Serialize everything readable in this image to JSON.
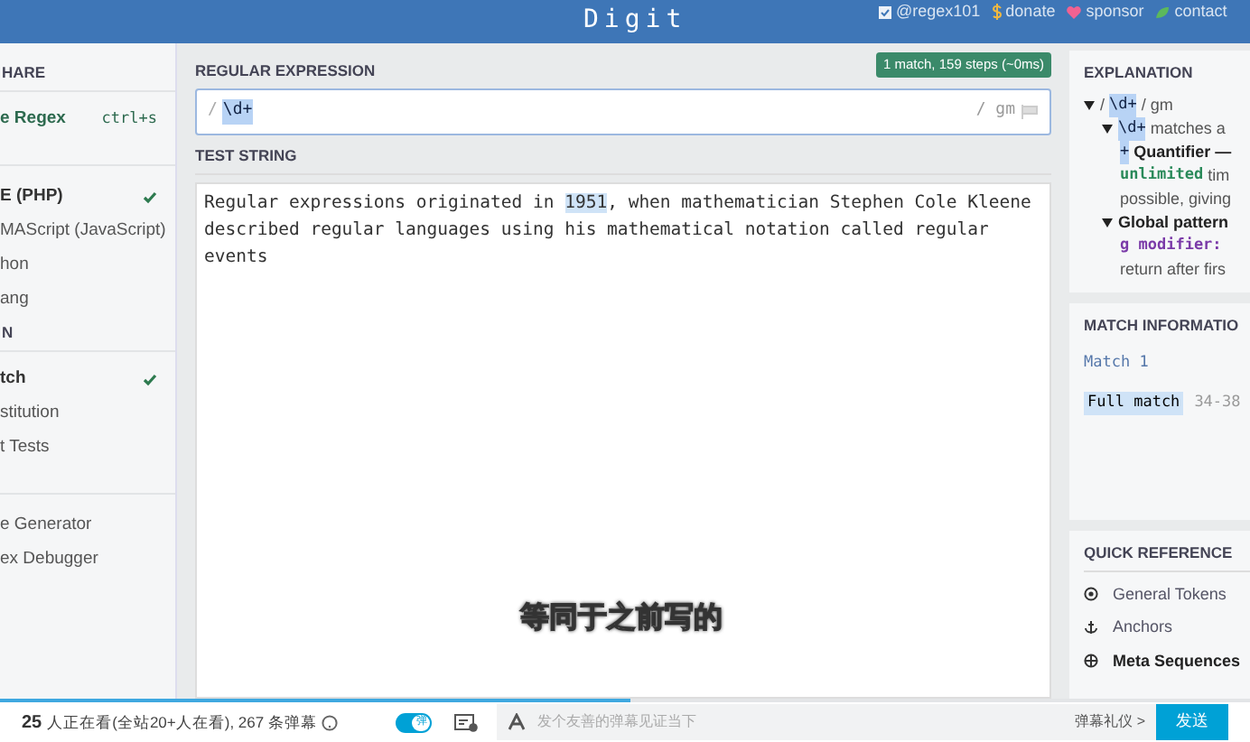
{
  "header": {
    "title": "Digit",
    "links": [
      {
        "label": "@regex101",
        "kind": "check"
      },
      {
        "label": "donate",
        "kind": "dollar"
      },
      {
        "label": "sponsor",
        "kind": "heart"
      },
      {
        "label": "contact",
        "kind": "leaf"
      }
    ]
  },
  "sidebar": [
    {
      "kind": "heading",
      "label": "HARE"
    },
    {
      "kind": "save",
      "label": "e Regex",
      "shortcut": "ctrl+s"
    },
    {
      "kind": "gap"
    },
    {
      "kind": "item",
      "label": "E (PHP)",
      "bold": true,
      "checked": true
    },
    {
      "kind": "item",
      "label": "MAScript (JavaScript)",
      "bold": false,
      "checked": false
    },
    {
      "kind": "item",
      "label": "hon",
      "bold": false,
      "checked": false
    },
    {
      "kind": "item",
      "label": "ang",
      "bold": false,
      "checked": false
    },
    {
      "kind": "heading",
      "label": "N"
    },
    {
      "kind": "item",
      "label": "tch",
      "bold": true,
      "checked": true
    },
    {
      "kind": "item",
      "label": "stitution",
      "bold": false,
      "checked": false
    },
    {
      "kind": "item",
      "label": "t Tests",
      "bold": false,
      "checked": false
    },
    {
      "kind": "gap"
    },
    {
      "kind": "item",
      "label": "e Generator",
      "bold": false,
      "checked": false
    },
    {
      "kind": "item",
      "label": "ex Debugger",
      "bold": false,
      "checked": false
    }
  ],
  "regex": {
    "heading": "REGULAR EXPRESSION",
    "status": "1 match, 159 steps (~0ms)",
    "delimiter": "/",
    "pattern": "\\d+",
    "flags": "/ gm"
  },
  "test_string": {
    "heading": "TEST STRING",
    "before": "Regular expressions originated in ",
    "match": "1951",
    "after": ", when mathematician Stephen Cole Kleene described regular languages using his mathematical notation called regular events"
  },
  "subtitle": "等同于之前写的",
  "explanation": {
    "heading": "EXPLANATION",
    "lines": [
      [
        {
          "kind": "caret"
        },
        {
          "kind": "plain",
          "text": "/ "
        },
        {
          "kind": "token",
          "text": "\\d+"
        },
        {
          "kind": "plain",
          "text": " / gm"
        }
      ],
      [
        {
          "kind": "indent"
        },
        {
          "kind": "caret"
        },
        {
          "kind": "token",
          "text": "\\d+"
        },
        {
          "kind": "plain",
          "text": " matches a"
        }
      ],
      [
        {
          "kind": "indent2"
        },
        {
          "kind": "token",
          "text": "+"
        },
        {
          "kind": "bold",
          "text": " Quantifier —"
        }
      ],
      [
        {
          "kind": "indent2"
        },
        {
          "kind": "green",
          "text": "unlimited"
        },
        {
          "kind": "plain",
          "text": " tim"
        }
      ],
      [
        {
          "kind": "indent2"
        },
        {
          "kind": "plain",
          "text": "possible, giving"
        }
      ],
      [
        {
          "kind": "indent"
        },
        {
          "kind": "caret"
        },
        {
          "kind": "bold",
          "text": "Global pattern"
        }
      ],
      [
        {
          "kind": "indent2"
        },
        {
          "kind": "purple",
          "text": "g modifier:"
        }
      ],
      [
        {
          "kind": "indent2"
        },
        {
          "kind": "plain",
          "text": "return after firs"
        }
      ]
    ]
  },
  "match_info": {
    "heading": "MATCH INFORMATIO",
    "match": "Match 1",
    "label": "Full match",
    "range": "34-38"
  },
  "quick_reference": {
    "heading": "QUICK REFERENCE",
    "items": [
      {
        "label": "General Tokens",
        "kind": "target",
        "bold": false
      },
      {
        "label": "Anchors",
        "kind": "anchor",
        "bold": false
      },
      {
        "label": "Meta Sequences",
        "kind": "globe",
        "bold": true
      }
    ]
  },
  "player": {
    "level": 0.505,
    "viewers": "25",
    "viewers_text": "人正在看(全站20+人在看), 267 条弹幕",
    "danmaku_on": true,
    "toggle_label": "弹",
    "placeholder": "发个友善的弹幕见证当下",
    "etiquette": "弹幕礼仪 >",
    "send": "发送"
  }
}
